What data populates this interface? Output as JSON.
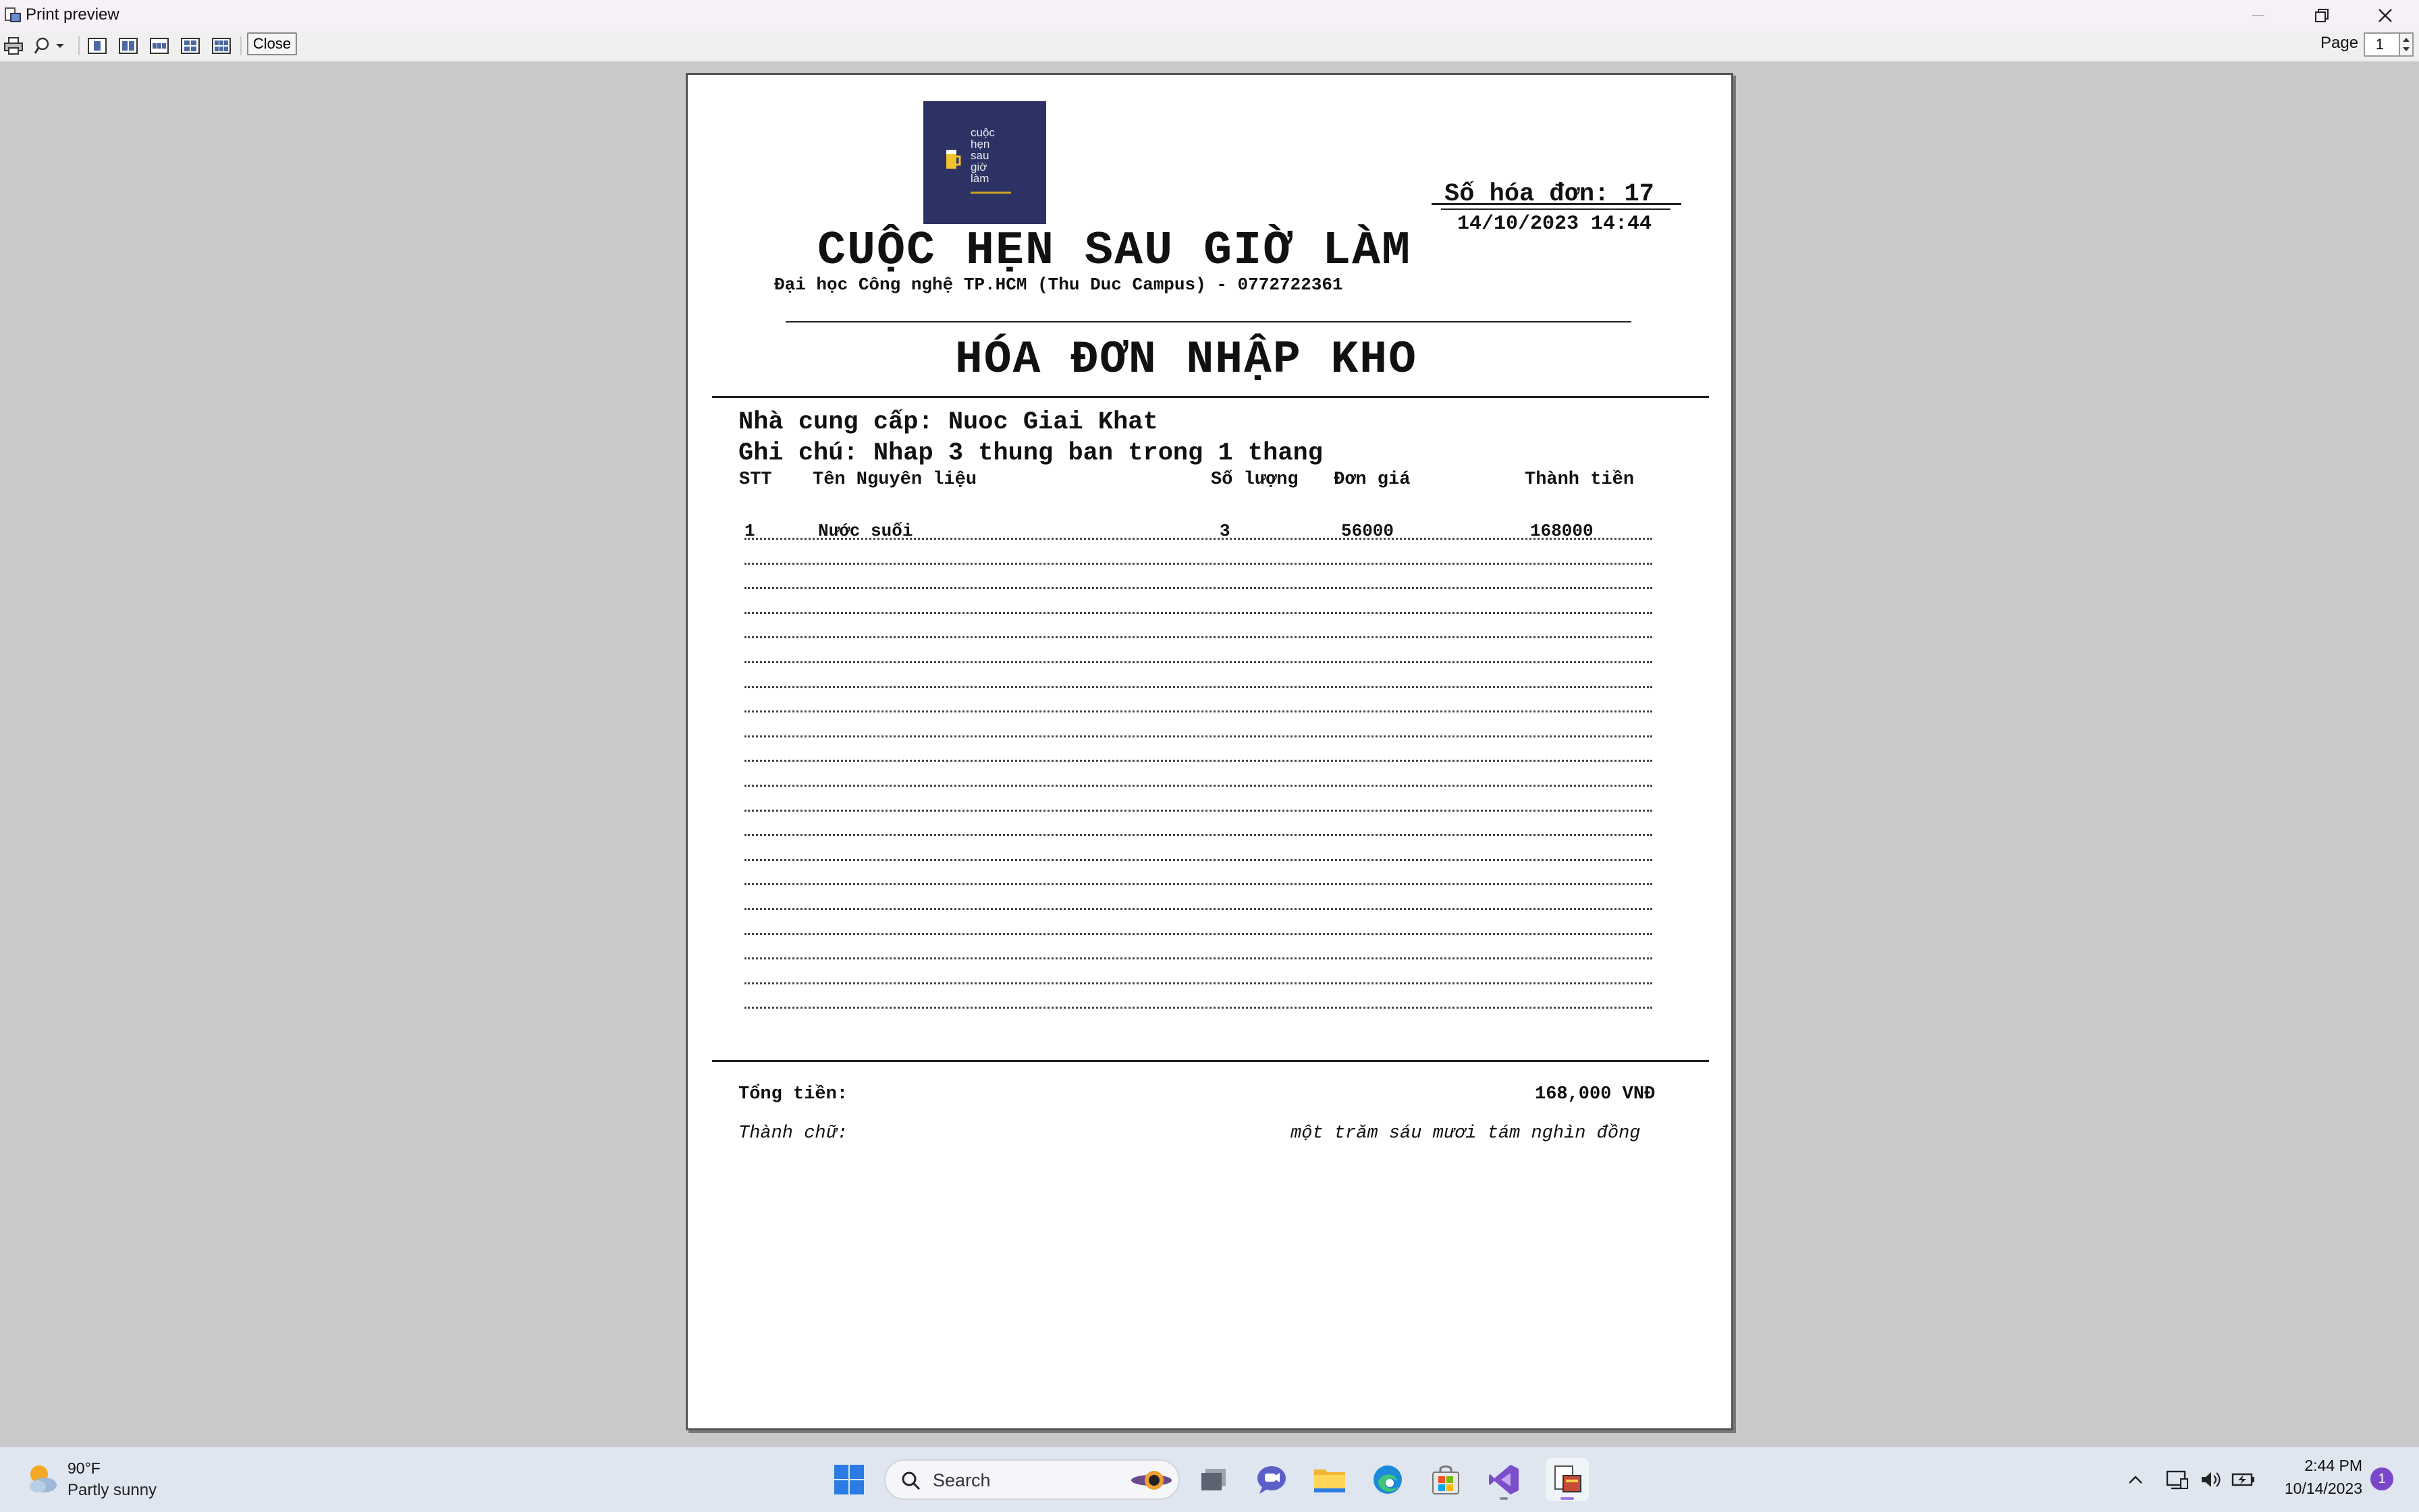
{
  "window": {
    "title": "Print preview"
  },
  "toolbar": {
    "close_label": "Close",
    "page_label": "Page",
    "page_value": "1"
  },
  "invoice": {
    "logo_text": "cuộc\nhẹn\nsau\ngiờ\nlàm",
    "invoice_number": "Số hóa đơn: 17",
    "datetime": "14/10/2023 14:44",
    "shop_name": "CUỘC HẸN SAU GIỜ LÀM",
    "address": "Đại học Công nghệ TP.HCM (Thu Duc Campus) - 0772722361",
    "doc_title": "HÓA ĐƠN NHẬP KHO",
    "supplier": "Nhà cung cấp: Nuoc Giai Khat",
    "note": "Ghi chú: Nhap 3 thung ban trong 1 thang",
    "columns": [
      "STT",
      "Tên Nguyên liệu",
      "Số lượng",
      "Đơn giá",
      "Thành tiền"
    ],
    "rows": [
      {
        "stt": "1",
        "name": "Nước suối",
        "qty": "3",
        "price": "56000",
        "amount": "168000"
      }
    ],
    "total_label": "Tổng tiền:",
    "total_value": "168,000 VNĐ",
    "words_label": "Thành chữ:",
    "words_value": "một trăm sáu mươi tám nghìn đồng"
  },
  "taskbar": {
    "weather_temp": "90°F",
    "weather_condition": "Partly sunny",
    "search_placeholder": "Search",
    "clock_time": "2:44 PM",
    "clock_date": "10/14/2023",
    "notification_count": "1"
  },
  "colors": {
    "page_background": "#c9c9c9",
    "logo_background": "#2c3364",
    "notification_badge": "#7a47c9"
  }
}
